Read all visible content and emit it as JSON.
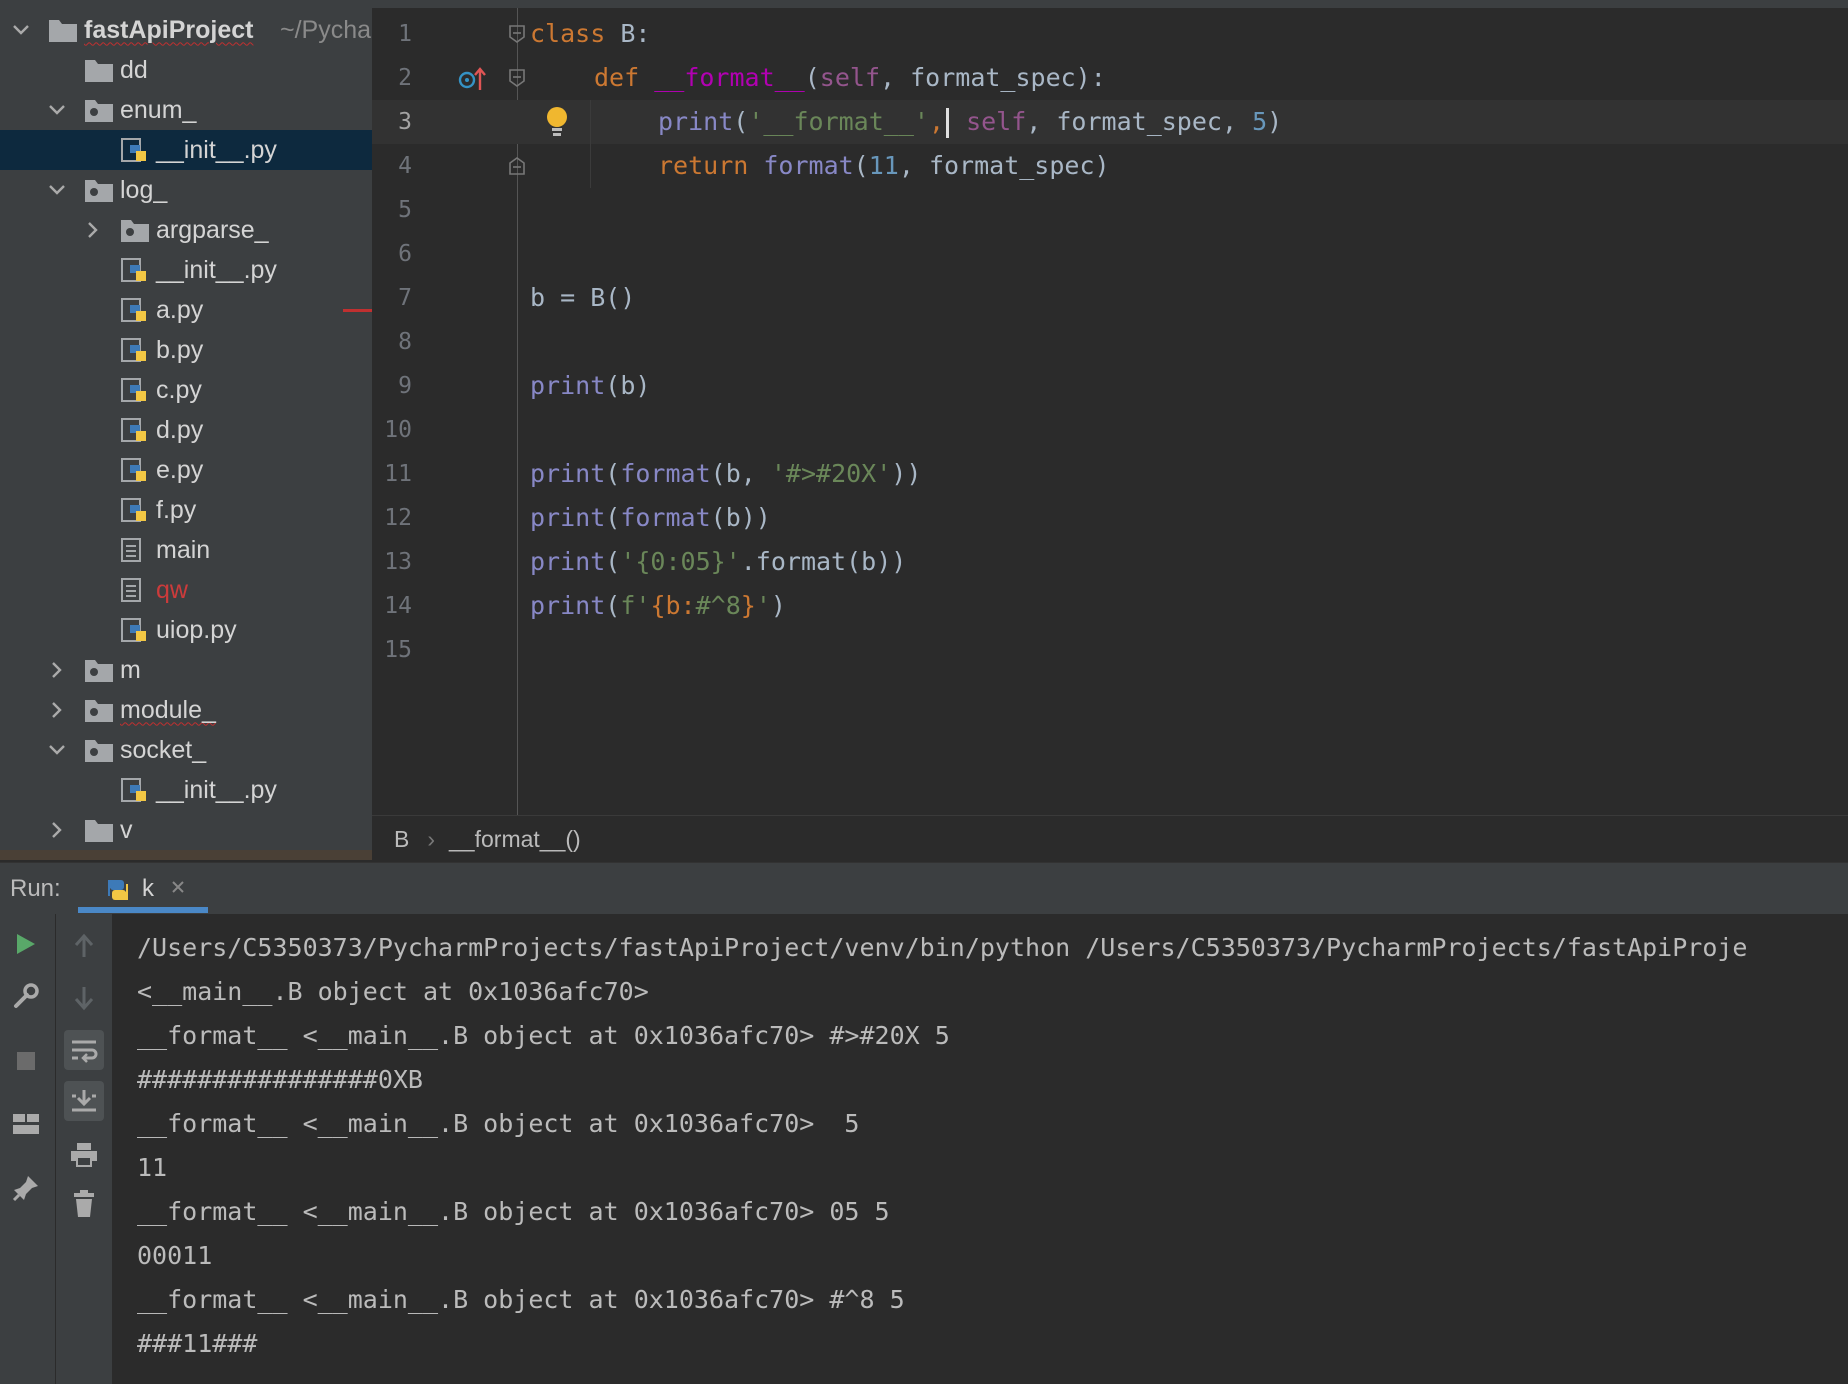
{
  "project": {
    "root_label": "fastApiProject",
    "root_path": "~/Pycha",
    "items": [
      {
        "label": "dd",
        "type": "folder"
      },
      {
        "label": "enum_",
        "type": "package"
      },
      {
        "label": "__init__.py",
        "type": "python"
      },
      {
        "label": "log_",
        "type": "package"
      },
      {
        "label": "argparse_",
        "type": "package"
      },
      {
        "label": "__init__.py",
        "type": "python"
      },
      {
        "label": "a.py",
        "type": "python"
      },
      {
        "label": "b.py",
        "type": "python"
      },
      {
        "label": "c.py",
        "type": "python"
      },
      {
        "label": "d.py",
        "type": "python"
      },
      {
        "label": "e.py",
        "type": "python"
      },
      {
        "label": "f.py",
        "type": "python"
      },
      {
        "label": "main",
        "type": "text"
      },
      {
        "label": "qw",
        "type": "text"
      },
      {
        "label": "uiop.py",
        "type": "python"
      },
      {
        "label": "m",
        "type": "package"
      },
      {
        "label": "module_",
        "type": "package"
      },
      {
        "label": "socket_",
        "type": "package"
      },
      {
        "label": "__init__.py",
        "type": "python"
      },
      {
        "label": "v",
        "type": "folder"
      }
    ]
  },
  "editor": {
    "line_numbers": [
      "1",
      "2",
      "3",
      "4",
      "5",
      "6",
      "7",
      "8",
      "9",
      "10",
      "11",
      "12",
      "13",
      "14",
      "15"
    ],
    "current_line": 3,
    "code": {
      "l1_kw": "class",
      "l1_rest": " B:",
      "l2_kw": "def",
      "l2_fn": "__format__",
      "l2_open": "(",
      "l2_self": "self",
      "l2_rest": ", format_spec):",
      "l3_fn": "print",
      "l3_open": "(",
      "l3_str": "'__format__'",
      "l3_comma": ",",
      "l3_self": " self",
      "l3_mid": ", format_spec, ",
      "l3_num": "5",
      "l3_close": ")",
      "l4_kw": "return",
      "l4_fn": " format",
      "l4_open": "(",
      "l4_num": "11",
      "l4_rest": ", format_spec)",
      "l7": "b = B()",
      "l9_fn": "print",
      "l9_rest": "(b)",
      "l11_fn": "print",
      "l11_open": "(",
      "l11_fn2": "format",
      "l11_mid": "(b, ",
      "l11_str": "'#>#20X'",
      "l11_close": "))",
      "l12_fn": "print",
      "l12_open": "(",
      "l12_fn2": "format",
      "l12_close": "(b))",
      "l13_fn": "print",
      "l13_open": "(",
      "l13_str": "'{0:05}'",
      "l13_rest": ".format(b))",
      "l14_fn": "print",
      "l14_open": "(",
      "l14_str1": "f'",
      "l14_brace": "{b:",
      "l14_str2": "#^8",
      "l14_brace2": "}",
      "l14_str3": "'",
      "l14_close": ")"
    }
  },
  "breadcrumb": {
    "class": "B",
    "method": "__format__()"
  },
  "run": {
    "title": "Run:",
    "tab_label": "k",
    "output": [
      "/Users/C5350373/PycharmProjects/fastApiProject/venv/bin/python /Users/C5350373/PycharmProjects/fastApiProje",
      "<__main__.B object at 0x1036afc70>",
      "__format__ <__main__.B object at 0x1036afc70> #>#20X 5",
      "################0XB",
      "__format__ <__main__.B object at 0x1036afc70>  5",
      "11",
      "__format__ <__main__.B object at 0x1036afc70> 05 5",
      "00011",
      "__format__ <__main__.B object at 0x1036afc70> #^8 5",
      "###11###"
    ]
  },
  "colors": {
    "panel_bg": "#3c3f41",
    "editor_bg": "#2b2b2b",
    "selection": "#0d293e",
    "keyword": "#cc7832",
    "string": "#6a8759",
    "number": "#6897bb",
    "magic_method": "#ff00a8",
    "self": "#94558d",
    "builtin": "#8888c6",
    "run_green": "#59a869"
  },
  "icons": [
    "chevron-down-icon",
    "chevron-right-icon",
    "folder-icon",
    "package-icon",
    "python-file-icon",
    "text-file-icon",
    "override-icon",
    "lightbulb-icon",
    "fold-icon",
    "run-icon",
    "wrench-icon",
    "stop-icon",
    "layout-icon",
    "pin-icon",
    "up-arrow-icon",
    "down-arrow-icon",
    "soft-wrap-icon",
    "scroll-to-end-icon",
    "print-icon",
    "trash-icon",
    "close-icon"
  ]
}
